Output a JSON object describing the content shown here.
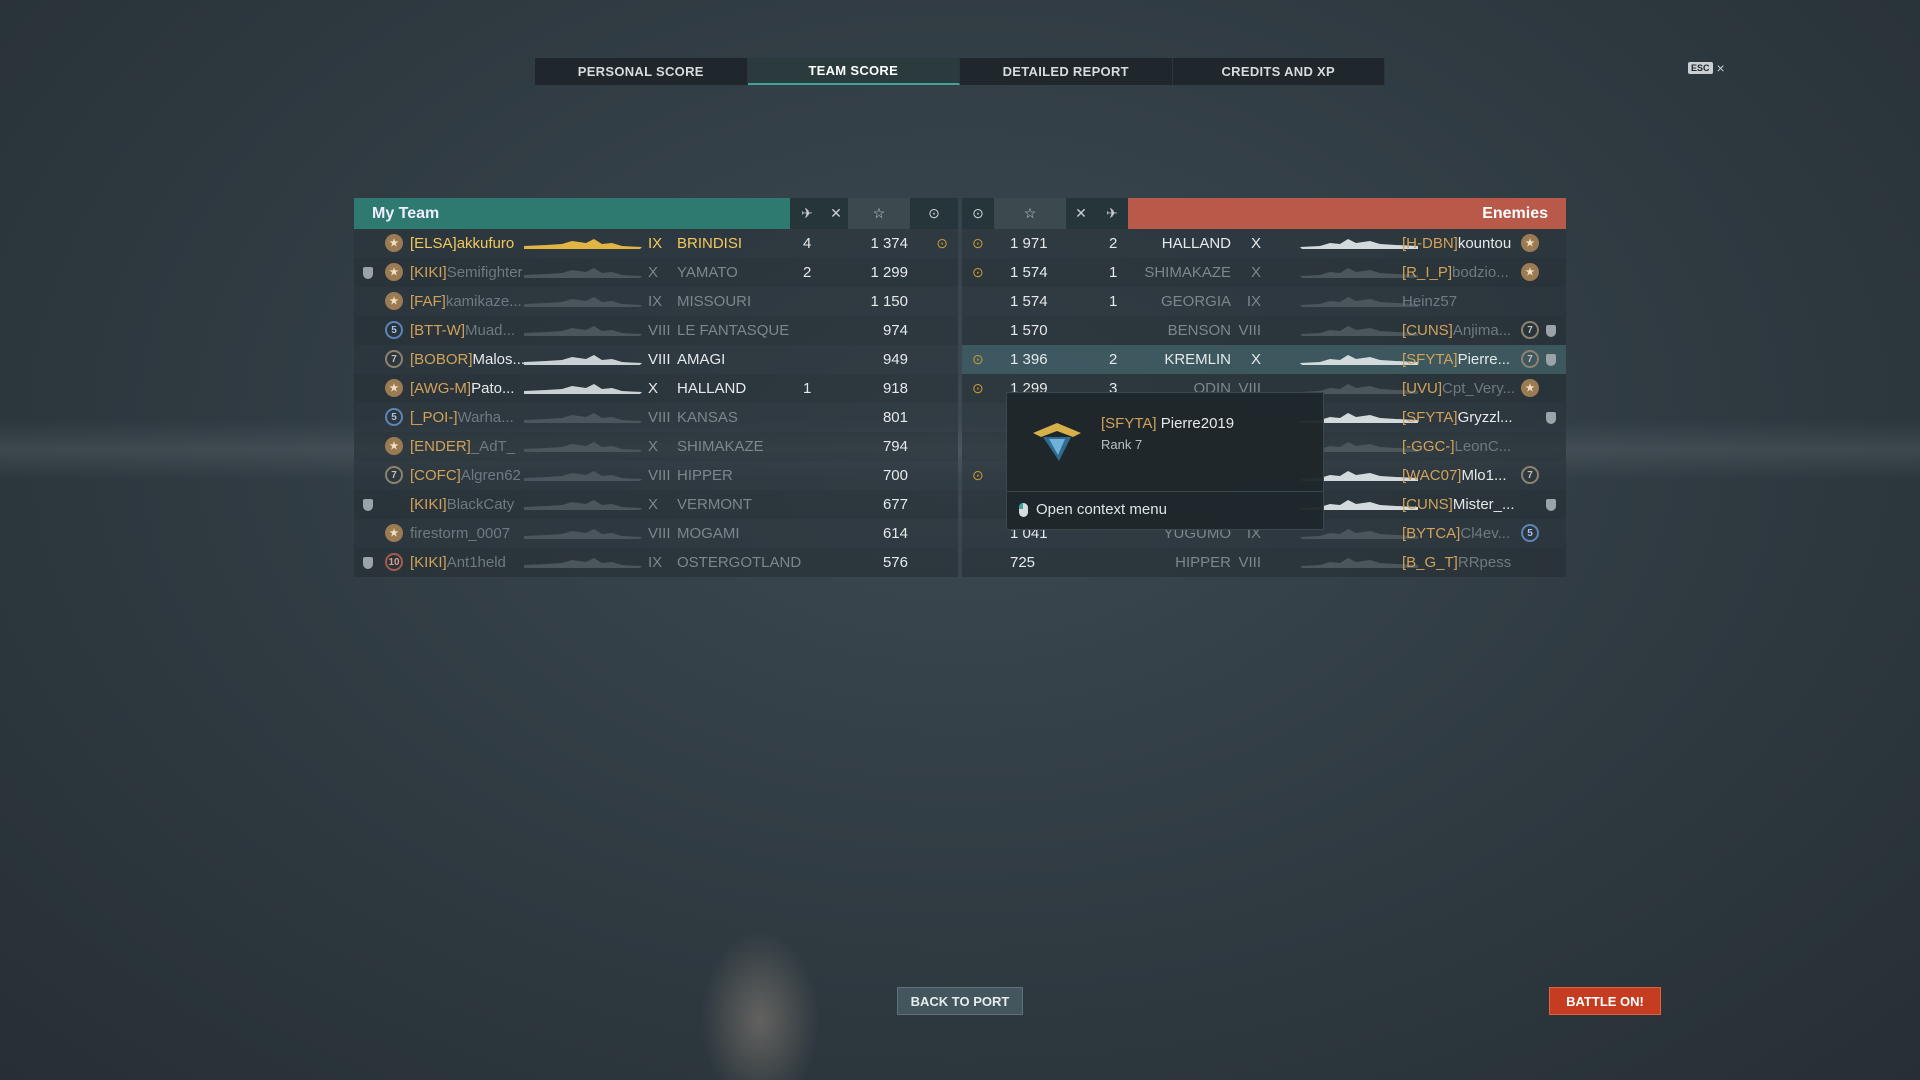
{
  "tabs": [
    "PERSONAL SCORE",
    "TEAM SCORE",
    "DETAILED REPORT",
    "CREDITS AND XP"
  ],
  "esc_label": "ESC",
  "close_glyph": "×",
  "my_team": {
    "title": "My Team",
    "rows": [
      {
        "clan": "[ELSA]",
        "nick": "akkufuro",
        "tier": "IX",
        "ship": "BRINDISI",
        "kills": "4",
        "planes": "",
        "xp": "1 374",
        "badge": "★",
        "shield": false,
        "damage": true,
        "you": true,
        "dim": false
      },
      {
        "clan": "[KIKI]",
        "nick": "Semifighter",
        "tier": "X",
        "ship": "YAMATO",
        "kills": "2",
        "planes": "",
        "xp": "1 299",
        "badge": "★",
        "shield": true,
        "damage": false,
        "you": false,
        "dim": true
      },
      {
        "clan": "[FAF]",
        "nick": "kamikaze...",
        "tier": "IX",
        "ship": "MISSOURI",
        "kills": "",
        "planes": "",
        "xp": "1 150",
        "badge": "★",
        "shield": false,
        "damage": false,
        "you": false,
        "dim": true
      },
      {
        "clan": "[BTT-W]",
        "nick": "Muad...",
        "tier": "VIII",
        "ship": "LE FANTASQUE",
        "kills": "",
        "planes": "",
        "xp": "974",
        "badge": "5",
        "shield": false,
        "damage": false,
        "you": false,
        "dim": true
      },
      {
        "clan": "[BOBOR]",
        "nick": "Malos...",
        "tier": "VIII",
        "ship": "AMAGI",
        "kills": "",
        "planes": "",
        "xp": "949",
        "badge": "7",
        "shield": false,
        "damage": false,
        "you": false,
        "dim": false
      },
      {
        "clan": "[AWG-M]",
        "nick": "Pato...",
        "tier": "X",
        "ship": "HALLAND",
        "kills": "",
        "planes": "1",
        "xp": "918",
        "badge": "★",
        "shield": false,
        "damage": false,
        "you": false,
        "dim": false
      },
      {
        "clan": "[_POI-]",
        "nick": "Warha...",
        "tier": "VIII",
        "ship": "KANSAS",
        "kills": "",
        "planes": "",
        "xp": "801",
        "badge": "5",
        "shield": false,
        "damage": false,
        "you": false,
        "dim": true
      },
      {
        "clan": "[ENDER]",
        "nick": "_AdT_",
        "tier": "X",
        "ship": "SHIMAKAZE",
        "kills": "",
        "planes": "",
        "xp": "794",
        "badge": "★",
        "shield": false,
        "damage": false,
        "you": false,
        "dim": true
      },
      {
        "clan": "[COFC]",
        "nick": "Algren62",
        "tier": "VIII",
        "ship": "HIPPER",
        "kills": "",
        "planes": "",
        "xp": "700",
        "badge": "7",
        "shield": false,
        "damage": false,
        "you": false,
        "dim": true
      },
      {
        "clan": "[KIKI]",
        "nick": "BlackCaty",
        "tier": "X",
        "ship": "VERMONT",
        "kills": "",
        "planes": "",
        "xp": "677",
        "badge": "",
        "shield": true,
        "damage": false,
        "you": false,
        "dim": true
      },
      {
        "clan": "",
        "nick": "firestorm_0007",
        "tier": "VIII",
        "ship": "MOGAMI",
        "kills": "",
        "planes": "",
        "xp": "614",
        "badge": "★",
        "shield": false,
        "damage": false,
        "you": false,
        "dim": true
      },
      {
        "clan": "[KIKI]",
        "nick": "Ant1held",
        "tier": "IX",
        "ship": "OSTERGOTLAND",
        "kills": "",
        "planes": "",
        "xp": "576",
        "badge": "10",
        "shield": true,
        "damage": false,
        "you": false,
        "dim": true
      }
    ]
  },
  "enemies": {
    "title": "Enemies",
    "rows": [
      {
        "clan": "[H-DBN]",
        "nick": "kountou",
        "tier": "X",
        "ship": "HALLAND",
        "kills": "2",
        "xp": "1 971",
        "badge": "★",
        "shield": false,
        "damage": true,
        "dim": false,
        "hl": false
      },
      {
        "clan": "[R_I_P]",
        "nick": "bodzio...",
        "tier": "X",
        "ship": "SHIMAKAZE",
        "kills": "1",
        "xp": "1 574",
        "badge": "★",
        "shield": false,
        "damage": true,
        "dim": true,
        "hl": false
      },
      {
        "clan": "",
        "nick": "Heinz57",
        "tier": "IX",
        "ship": "GEORGIA",
        "kills": "1",
        "xp": "1 574",
        "badge": "",
        "shield": false,
        "damage": false,
        "dim": true,
        "hl": false
      },
      {
        "clan": "[CUNS]",
        "nick": "Anjima...",
        "tier": "VIII",
        "ship": "BENSON",
        "kills": "",
        "xp": "1 570",
        "badge": "7",
        "shield": true,
        "damage": false,
        "dim": true,
        "hl": false
      },
      {
        "clan": "[SFYTA]",
        "nick": "Pierre...",
        "tier": "X",
        "ship": "KREMLIN",
        "kills": "2",
        "xp": "1 396",
        "badge": "7",
        "shield": true,
        "damage": true,
        "dim": false,
        "hl": true
      },
      {
        "clan": "[UVU]",
        "nick": "Cpt_Very...",
        "tier": "VIII",
        "ship": "ODIN",
        "kills": "3",
        "xp": "1 299",
        "badge": "★",
        "shield": false,
        "damage": true,
        "dim": true,
        "hl": false
      },
      {
        "clan": "[SFYTA]",
        "nick": "Gryzzl...",
        "tier": "",
        "ship": "",
        "kills": "",
        "xp": "",
        "badge": "",
        "shield": true,
        "damage": false,
        "dim": false,
        "hl": false
      },
      {
        "clan": "[-GGC-]",
        "nick": "LeonC...",
        "tier": "",
        "ship": "",
        "kills": "",
        "xp": "",
        "badge": "",
        "shield": false,
        "damage": false,
        "dim": true,
        "hl": false
      },
      {
        "clan": "[WAC07]",
        "nick": "Mlo1...",
        "tier": "",
        "ship": "",
        "kills": "",
        "xp": "",
        "badge": "7",
        "shield": false,
        "damage": true,
        "dim": false,
        "hl": false
      },
      {
        "clan": "[CUNS]",
        "nick": "Mister_...",
        "tier": "",
        "ship": "",
        "kills": "",
        "xp": "",
        "badge": "",
        "shield": true,
        "damage": false,
        "dim": false,
        "hl": false
      },
      {
        "clan": "[BYTCA]",
        "nick": "Cl4ev...",
        "tier": "IX",
        "ship": "YUGUMO",
        "kills": "",
        "xp": "1 041",
        "badge": "5",
        "shield": false,
        "damage": false,
        "dim": true,
        "hl": false
      },
      {
        "clan": "[B_G_T]",
        "nick": "RRpess",
        "tier": "VIII",
        "ship": "HIPPER",
        "kills": "",
        "xp": "725",
        "badge": "",
        "shield": false,
        "damage": false,
        "dim": true,
        "hl": false
      }
    ]
  },
  "tooltip": {
    "clan": "[SFYTA]",
    "nick": "Pierre2019",
    "rank": "Rank 7",
    "context": "Open context menu"
  },
  "buttons": {
    "back_to_port": "BACK TO PORT",
    "battle_on": "BATTLE ON!"
  },
  "colors": {
    "my_team_header": "#2f7a70",
    "enemies_header": "#b8594a",
    "clan_tag": "#d1a25a",
    "player_highlight": "#f3c95b",
    "battle_button": "#c53c20"
  },
  "icons": {
    "columns": [
      "planes-shot-icon",
      "ships-destroyed-icon",
      "base-xp-star-icon",
      "damage-icon"
    ]
  }
}
